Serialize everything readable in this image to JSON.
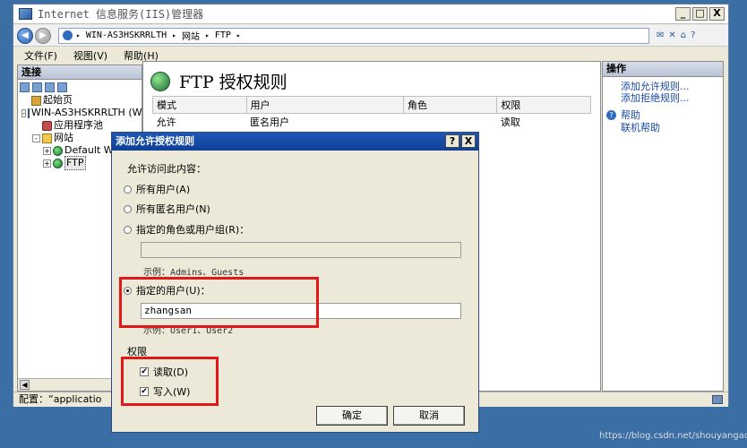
{
  "window": {
    "title": "Internet 信息服务(IIS)管理器",
    "controls": [
      "_",
      "□",
      "X"
    ]
  },
  "address": {
    "segments": [
      "WIN-AS3HSKRRLTH",
      "网站",
      "FTP"
    ],
    "separator": "▸",
    "tools": [
      "✉",
      "✕",
      "⌂",
      "?"
    ]
  },
  "menu": {
    "items": [
      "文件(F)",
      "视图(V)",
      "帮助(H)"
    ]
  },
  "connections": {
    "header": "连接",
    "tree": [
      {
        "label": "起始页",
        "indent": 0,
        "expander": "",
        "icon": "home"
      },
      {
        "label": "WIN-AS3HSKRRLTH (W",
        "indent": 0,
        "expander": "-",
        "icon": "server"
      },
      {
        "label": "应用程序池",
        "indent": 1,
        "expander": "",
        "icon": "pool"
      },
      {
        "label": "网站",
        "indent": 1,
        "expander": "-",
        "icon": "folder"
      },
      {
        "label": "Default W",
        "indent": 2,
        "expander": "+",
        "icon": "globe"
      },
      {
        "label": "FTP",
        "indent": 2,
        "expander": "+",
        "icon": "globe",
        "selected": true
      }
    ]
  },
  "center": {
    "title": "FTP 授权规则",
    "columns": [
      "模式",
      "用户",
      "角色",
      "权限"
    ],
    "rows": [
      [
        "允许",
        "匿名用户",
        "",
        "读取"
      ]
    ]
  },
  "actions": {
    "header": "操作",
    "links": [
      "添加允许规则...",
      "添加拒绝规则..."
    ],
    "help": "帮助",
    "online_help": "联机帮助"
  },
  "status": {
    "text": "配置：“applicatio"
  },
  "dialog": {
    "title": "添加允许授权规则",
    "help_btn": "?",
    "close_btn": "X",
    "access_label": "允许访问此内容：",
    "radio_all_users": "所有用户(A)",
    "radio_anonymous": "所有匿名用户(N)",
    "radio_roles": "指定的角色或用户组(R)：",
    "roles_value": "",
    "roles_example": "示例：Admins、Guests",
    "radio_users": "指定的用户(U)：",
    "users_value": "zhangsan",
    "users_example": "示例：User1、User2",
    "permissions_label": "权限",
    "check_read": "读取(D)",
    "check_write": "写入(W)",
    "ok": "确定",
    "cancel": "取消",
    "selected_option": "users",
    "read_checked": true,
    "write_checked": true
  },
  "watermark": "https://blog.csdn.net/shouyangao",
  "colors": {
    "desktop": "#3a6ea5",
    "highlight": "#e21818",
    "dialog_title": "#1f57b5",
    "link": "#1a49a8"
  }
}
